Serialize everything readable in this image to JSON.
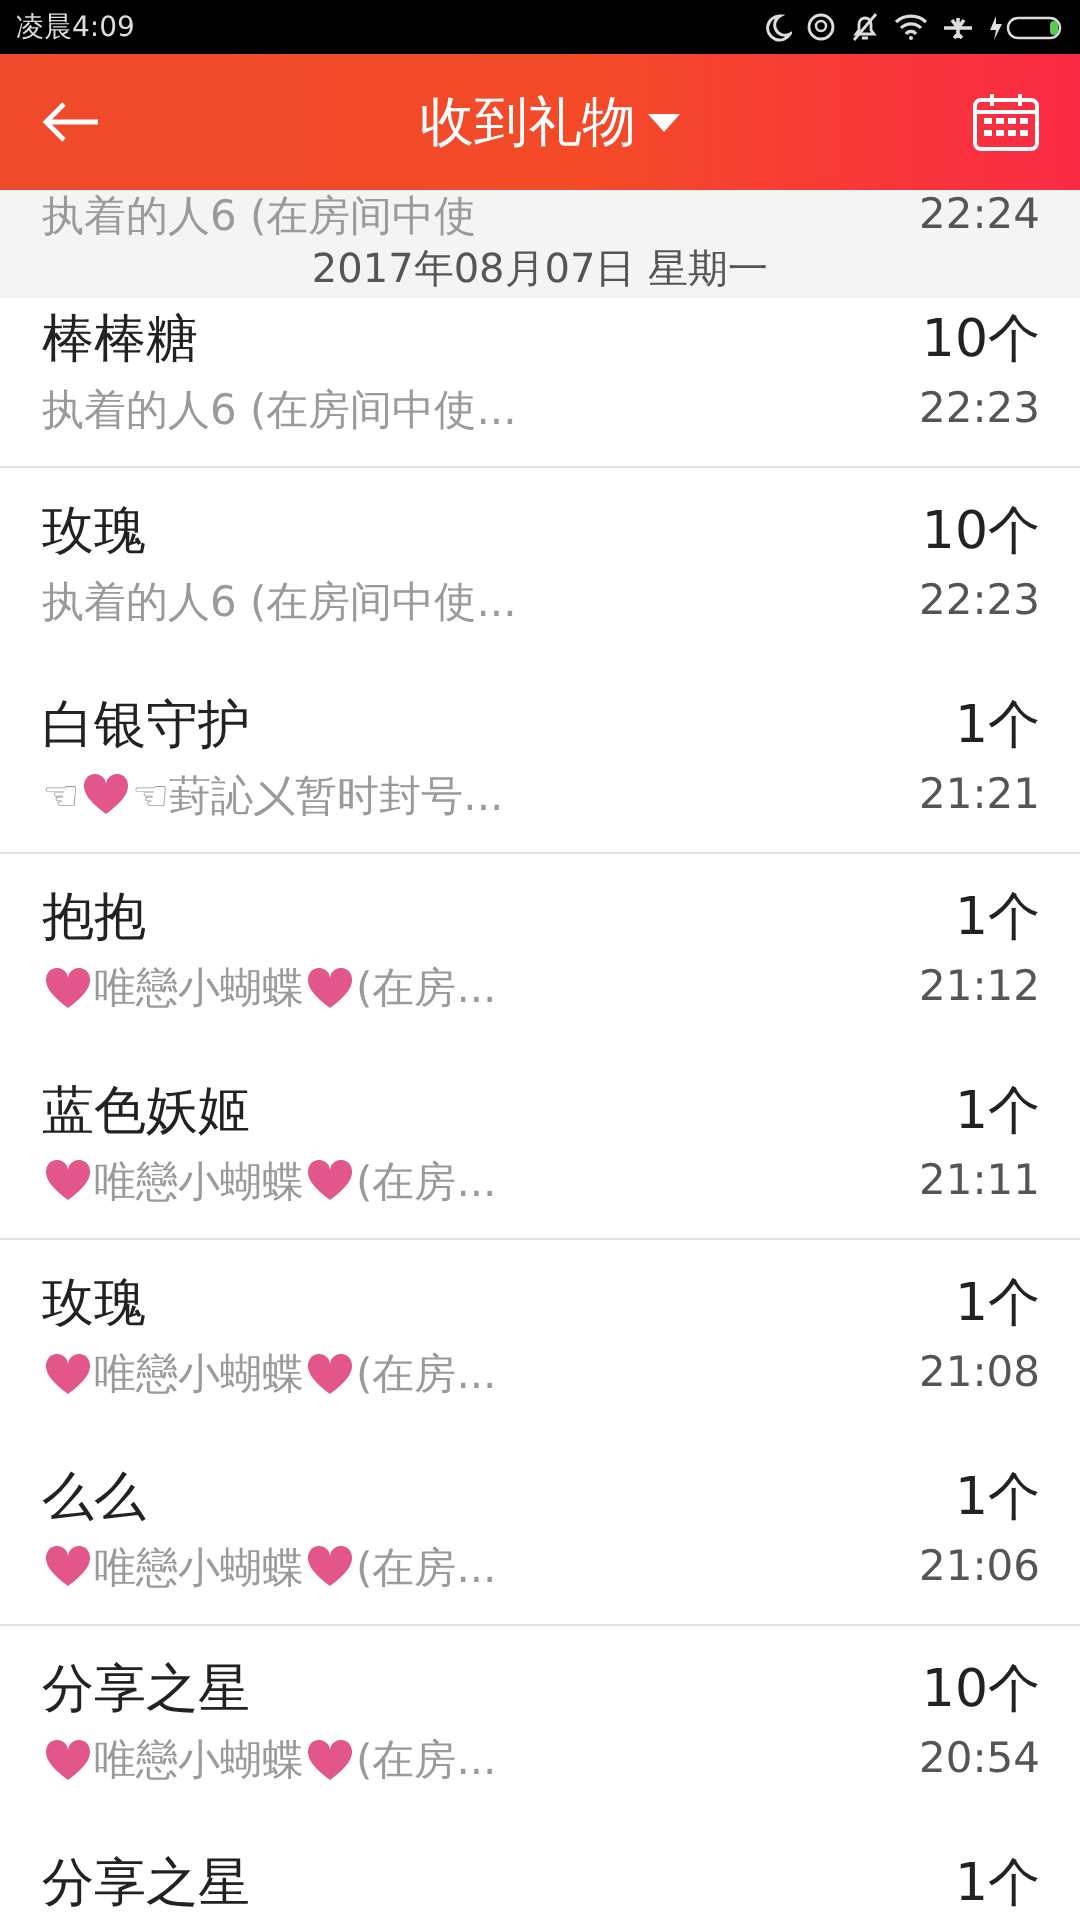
{
  "status_bar": {
    "time": "凌晨4:09"
  },
  "header": {
    "title": "收到礼物"
  },
  "date_header": {
    "label": "2017年08月07日 星期一"
  },
  "rows": [
    {
      "title": "",
      "count": "",
      "sender": [
        {
          "kind": "text",
          "text": "执着的人6 (在房间中使"
        }
      ],
      "time": "22:24",
      "divider": false
    },
    {
      "title": "棒棒糖",
      "count": "10个",
      "sender": [
        {
          "kind": "text",
          "text": "执着的人6 (在房间中使..."
        }
      ],
      "time": "22:23",
      "divider": true
    },
    {
      "title": "玫瑰",
      "count": "10个",
      "sender": [
        {
          "kind": "text",
          "text": "执着的人6 (在房间中使..."
        }
      ],
      "time": "22:23",
      "divider": false
    },
    {
      "title": "白银守护",
      "count": "1个",
      "sender": [
        {
          "kind": "text",
          "text": "☜"
        },
        {
          "kind": "heart"
        },
        {
          "kind": "text",
          "text": "☜葑訫㐅暂时封号..."
        }
      ],
      "time": "21:21",
      "divider": true
    },
    {
      "title": "抱抱",
      "count": "1个",
      "sender": [
        {
          "kind": "heart"
        },
        {
          "kind": "text",
          "text": "唯戀小蝴蝶"
        },
        {
          "kind": "heart"
        },
        {
          "kind": "text",
          "text": " (在房..."
        }
      ],
      "time": "21:12",
      "divider": false
    },
    {
      "title": "蓝色妖姬",
      "count": "1个",
      "sender": [
        {
          "kind": "heart"
        },
        {
          "kind": "text",
          "text": "唯戀小蝴蝶"
        },
        {
          "kind": "heart"
        },
        {
          "kind": "text",
          "text": " (在房..."
        }
      ],
      "time": "21:11",
      "divider": true
    },
    {
      "title": "玫瑰",
      "count": "1个",
      "sender": [
        {
          "kind": "heart"
        },
        {
          "kind": "text",
          "text": "唯戀小蝴蝶"
        },
        {
          "kind": "heart"
        },
        {
          "kind": "text",
          "text": " (在房..."
        }
      ],
      "time": "21:08",
      "divider": false
    },
    {
      "title": "么么",
      "count": "1个",
      "sender": [
        {
          "kind": "heart"
        },
        {
          "kind": "text",
          "text": "唯戀小蝴蝶"
        },
        {
          "kind": "heart"
        },
        {
          "kind": "text",
          "text": " (在房..."
        }
      ],
      "time": "21:06",
      "divider": true
    },
    {
      "title": "分享之星",
      "count": "10个",
      "sender": [
        {
          "kind": "heart"
        },
        {
          "kind": "text",
          "text": "唯戀小蝴蝶"
        },
        {
          "kind": "heart"
        },
        {
          "kind": "text",
          "text": " (在房..."
        }
      ],
      "time": "20:54",
      "divider": false
    },
    {
      "title": "分享之星",
      "count": "1个",
      "sender": [],
      "time": "",
      "divider": false
    }
  ]
}
